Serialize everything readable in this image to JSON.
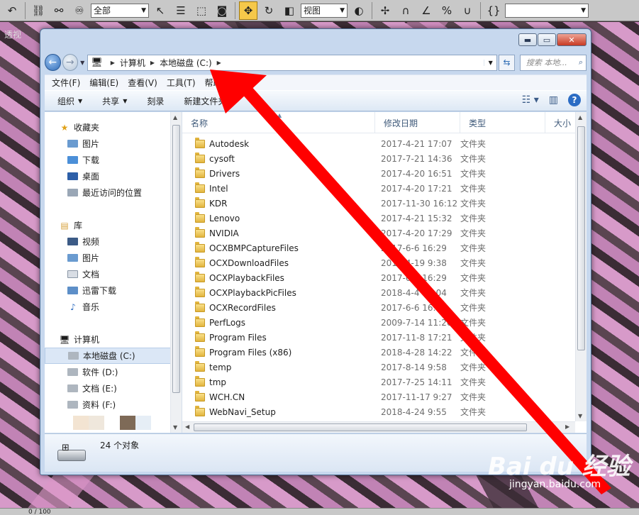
{
  "max_toolbar": {
    "selection_filter": "全部",
    "ref_coord": "视图"
  },
  "viewport": {
    "label": "透视"
  },
  "status": {
    "text": "0 / 100"
  },
  "explorer": {
    "breadcrumbs": [
      "计算机",
      "本地磁盘 (C:)"
    ],
    "search_placeholder": "搜索 本地...",
    "menu": [
      "文件(F)",
      "编辑(E)",
      "查看(V)",
      "工具(T)",
      "帮助(H)"
    ],
    "commands": {
      "organize": "组织",
      "share": "共享",
      "burn": "刻录",
      "new_folder": "新建文件夹"
    },
    "nav": {
      "favorites": {
        "label": "收藏夹",
        "items": [
          "图片",
          "下载",
          "桌面",
          "最近访问的位置"
        ]
      },
      "libraries": {
        "label": "库",
        "items": [
          "视频",
          "图片",
          "文档",
          "迅雷下载",
          "音乐"
        ]
      },
      "computer": {
        "label": "计算机",
        "items": [
          "本地磁盘 (C:)",
          "软件 (D:)",
          "文档 (E:)",
          "资料 (F:)"
        ]
      }
    },
    "columns": [
      "名称",
      "修改日期",
      "类型",
      "大小"
    ],
    "files": [
      {
        "name": "Autodesk",
        "date": "2017-4-21 17:07",
        "type": "文件夹"
      },
      {
        "name": "cysoft",
        "date": "2017-7-21 14:36",
        "type": "文件夹"
      },
      {
        "name": "Drivers",
        "date": "2017-4-20 16:51",
        "type": "文件夹"
      },
      {
        "name": "Intel",
        "date": "2017-4-20 17:21",
        "type": "文件夹"
      },
      {
        "name": "KDR",
        "date": "2017-11-30 16:12",
        "type": "文件夹"
      },
      {
        "name": "Lenovo",
        "date": "2017-4-21 15:32",
        "type": "文件夹"
      },
      {
        "name": "NVIDIA",
        "date": "2017-4-20 17:29",
        "type": "文件夹"
      },
      {
        "name": "OCXBMPCaptureFiles",
        "date": "2017-6-6 16:29",
        "type": "文件夹"
      },
      {
        "name": "OCXDownloadFiles",
        "date": "2018-4-19 9:38",
        "type": "文件夹"
      },
      {
        "name": "OCXPlaybackFiles",
        "date": "2017-6-6 16:29",
        "type": "文件夹"
      },
      {
        "name": "OCXPlaybackPicFiles",
        "date": "2018-4-4 14:04",
        "type": "文件夹"
      },
      {
        "name": "OCXRecordFiles",
        "date": "2017-6-6 16:29",
        "type": "文件夹"
      },
      {
        "name": "PerfLogs",
        "date": "2009-7-14 11:20",
        "type": "文件夹"
      },
      {
        "name": "Program Files",
        "date": "2017-11-8 17:21",
        "type": "文件夹"
      },
      {
        "name": "Program Files (x86)",
        "date": "2018-4-28 14:22",
        "type": "文件夹"
      },
      {
        "name": "temp",
        "date": "2017-8-14 9:58",
        "type": "文件夹"
      },
      {
        "name": "tmp",
        "date": "2017-7-25 14:11",
        "type": "文件夹"
      },
      {
        "name": "WCH.CN",
        "date": "2017-11-17 9:27",
        "type": "文件夹"
      },
      {
        "name": "WebNavi_Setup",
        "date": "2018-4-24 9:55",
        "type": "文件夹"
      }
    ],
    "status_count": "24 个对象"
  },
  "watermark": {
    "logo": "Bai du 经验",
    "url": "jingyan.baidu.com"
  },
  "colors": {
    "annotation_arrow": "#ff0000",
    "folder": "#e2b53e",
    "title_bar": "#c7d8ee"
  }
}
